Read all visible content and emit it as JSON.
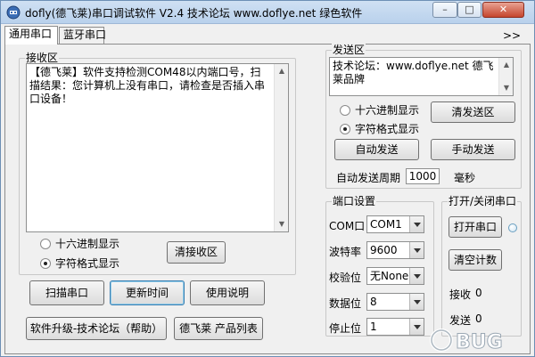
{
  "window": {
    "title": "dofly(德飞莱)串口调试软件 V2.4 技术论坛 www.doflye.net 绿色软件",
    "controls": {
      "minimize": "–",
      "maximize": "□",
      "close": "✕"
    }
  },
  "tabs": [
    {
      "label": "通用串口"
    },
    {
      "label": "蓝牙串口"
    }
  ],
  "more_label": ">>",
  "receive": {
    "group_label": "接收区",
    "text": "【德飞莱】软件支持检测COM48以内端口号，扫描结果：您计算机上没有串口，请检查是否插入串口设备！",
    "radio_hex": "十六进制显示",
    "radio_char": "字符格式显示",
    "clear_button": "清接收区"
  },
  "bottom_buttons": {
    "scan": "扫描串口",
    "update_time": "更新时间",
    "manual": "使用说明",
    "upgrade": "软件升级-技术论坛（帮助）",
    "products": "德飞莱 产品列表"
  },
  "send": {
    "group_label": "发送区",
    "text": "技术论坛：www.doflye.net 德飞莱品牌",
    "radio_hex": "十六进制显示",
    "radio_char": "字符格式显示",
    "clear_button": "清发送区",
    "auto_send_button": "自动发送",
    "manual_send_button": "手动发送",
    "period_label": "自动发送周期",
    "period_value": "1000",
    "period_unit": "毫秒"
  },
  "port_settings": {
    "group_label": "端口设置",
    "fields": [
      {
        "label": "COM口",
        "value": "COM1"
      },
      {
        "label": "波特率",
        "value": "9600"
      },
      {
        "label": "校验位",
        "value": "无None"
      },
      {
        "label": "数据位",
        "value": "8"
      },
      {
        "label": "停止位",
        "value": "1"
      }
    ]
  },
  "open_close": {
    "group_label": "打开/关闭串口",
    "open_button": "打开串口",
    "clear_count_button": "清空计数",
    "rx_label": "接收",
    "rx_value": "0",
    "tx_label": "发送",
    "tx_value": "0"
  },
  "watermark": {
    "text": "BUG"
  },
  "colors": {
    "title_bar": "#b9d1ec",
    "close_button": "#c5452d",
    "status_led": "#cfe4f2"
  }
}
